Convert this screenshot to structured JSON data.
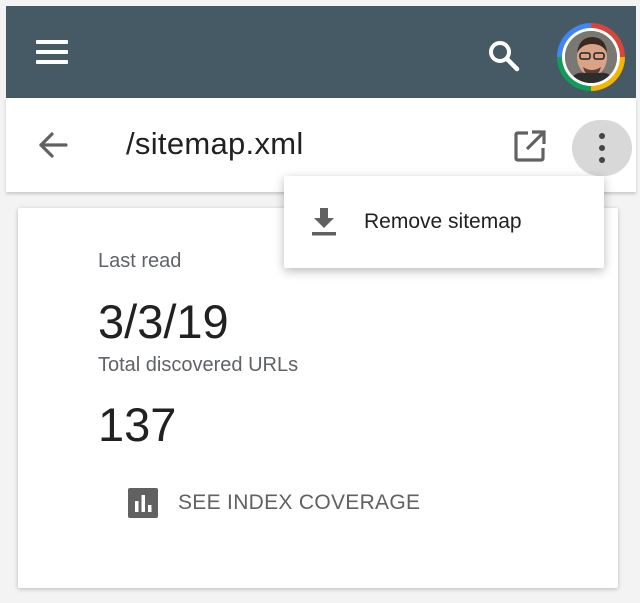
{
  "header": {
    "menu_icon": "menu-icon",
    "search_icon": "search-icon",
    "avatar": "avatar",
    "color": "#455a64"
  },
  "toolbar": {
    "back_icon": "arrow-back-icon",
    "title": "/sitemap.xml",
    "open_icon": "open-in-new-icon",
    "more_icon": "more-vert-icon"
  },
  "overflow_menu": {
    "items": [
      {
        "label": "Remove sitemap",
        "icon": "download-icon"
      }
    ]
  },
  "details": {
    "last_read_label": "Last read",
    "last_read_value": "3/3/19",
    "urls_label": "Total discovered URLs",
    "urls_value": "137",
    "coverage_icon": "bar-chart-icon",
    "coverage_label": "SEE INDEX COVERAGE"
  }
}
